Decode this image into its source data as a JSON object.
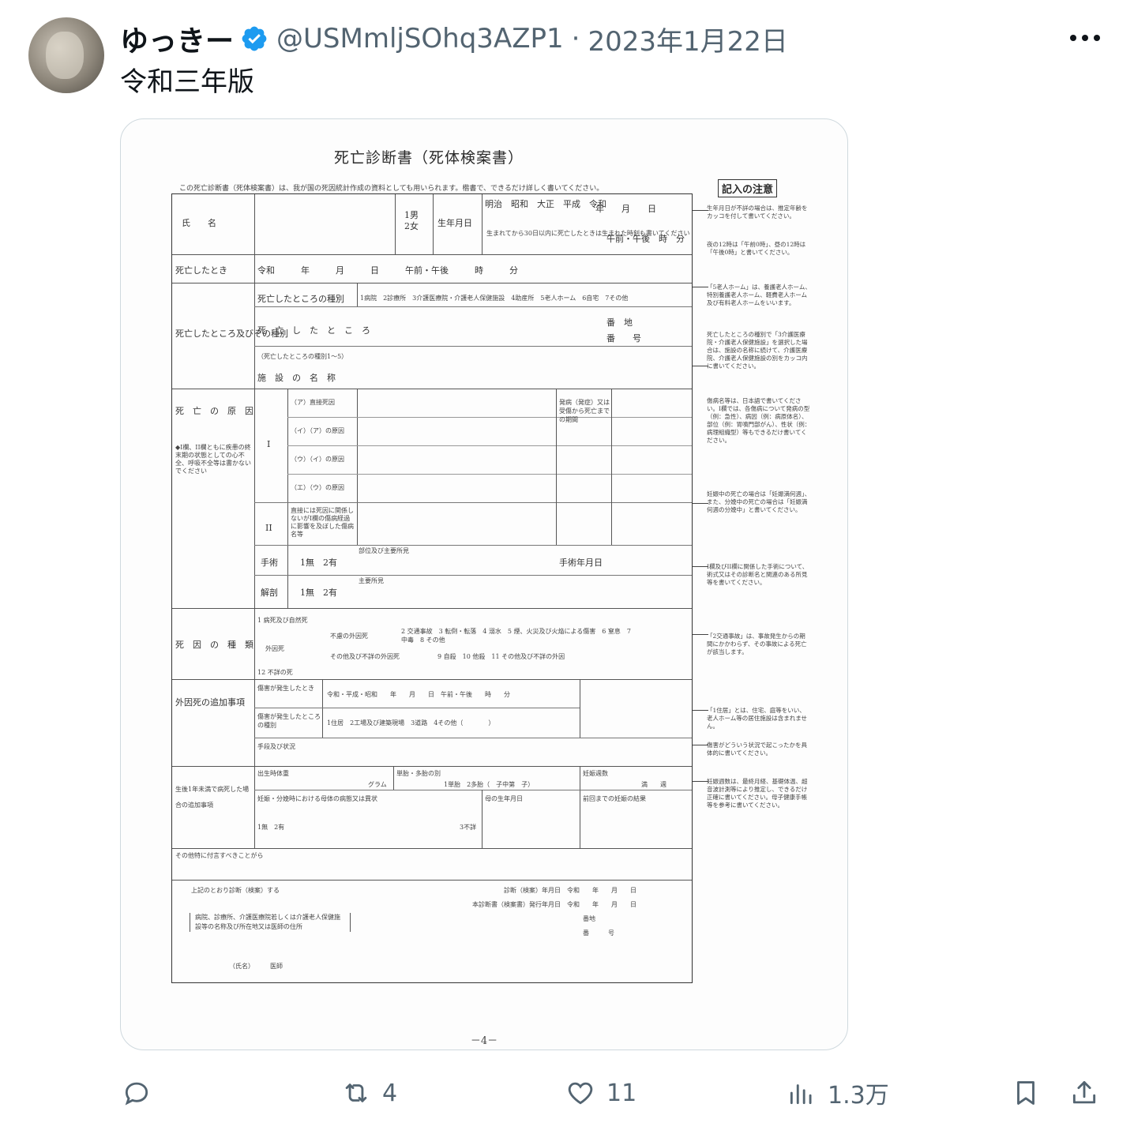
{
  "tweet": {
    "author_name": "ゆっきー",
    "handle": "@USMmljSOhq3AZP1",
    "separator": "·",
    "date": "2023年1月22日",
    "text": "令和三年版"
  },
  "document": {
    "title": "死亡診断書（死体検案書）",
    "intro": "この死亡診断書（死体検案書）は、我が国の死因統計作成の資料としても用いられます。楷書で、できるだけ詳しく書いてください。",
    "notes_header": "記入の注意",
    "page_number": "－4－",
    "rows": {
      "name": "氏　　名",
      "sex": "1男\n2女",
      "birth_label": "生年月日",
      "birth_eras": "明治　昭和　大正　平成　令和",
      "birth_ymd": "年　　月　　日",
      "birth_time": "午前・午後　時　分",
      "birth_note": "生まれてから30日以内に死亡したときは生まれた時刻も書いてください",
      "death_time_label": "死亡したとき",
      "death_time_value": "令和　　　年　　　月　　　日　　　午前・午後　　　時　　　分",
      "place_label": "死亡したところ及びその種別",
      "place_kind_label": "死亡したところの種別",
      "place_kind_value": "1病院　2診療所　3介護医療院・介護老人保健施設　4助産所　5老人ホーム　6自宅　7その他",
      "place_label2": "死　亡　し　た　と　こ　ろ",
      "place_addr": "番　地",
      "place_num": "番　　号",
      "facility_note": "（死亡したところの種別1～5）",
      "facility_label": "施　設　の　名　称",
      "cause_label": "死　亡　の　原　因",
      "cause_I": "I",
      "cause_II": "II",
      "cause_a": "（ア）直接死因",
      "cause_b": "（イ）（ア）の原因",
      "cause_c": "（ウ）（イ）の原因",
      "cause_d": "（エ）（ウ）の原因",
      "cause_II_note": "直接には死因に関係しないがI欄の傷病経過に影響を及ぼした傷病名等",
      "onset_note": "発病（発症）又は受傷から死亡までの期間",
      "cause_side_note": "◆I欄、II欄ともに疾患の終末期の状態としての心不全、呼吸不全等は書かないでください",
      "surgery_label": "手術",
      "surgery_value": "1無　2有",
      "surgery_detail": "部位及び主要所見",
      "surgery_date": "手術年月日",
      "autopsy_label": "解剖",
      "autopsy_value": "1無　2有",
      "autopsy_detail": "主要所見",
      "kind_label": "死　因　の　種　類",
      "kind_1": "1 病死及び自然死",
      "kind_ext": "外因死",
      "kind_unexpected": "不慮の外因死",
      "kind_unexpected_items": "2 交通事故　3 転倒・転落　4 溺水　5 煙、火災及び火焔による傷害　6 窒息　7 中毒　8 その他",
      "kind_other": "その他及び不詳の外因死",
      "kind_other_items": "9 自殺　10 他殺　11 その他及び不詳の外因",
      "kind_12": "12 不詳の死",
      "ext_label": "外因死の追加事項",
      "ext_when": "傷害が発生したとき",
      "ext_when_value": "令和・平成・昭和　　年　　月　　日　午前・午後　　時　　分",
      "ext_where": "傷害が発生したところの種別",
      "ext_where_value": "1住居　2工場及び建築現場　3道路　4その他（　　　　）",
      "ext_how": "手段及び状況",
      "infant_label": "生後1年未満で病死した場合の追加事項",
      "infant_weight": "出生時体重",
      "infant_gram": "グラム",
      "infant_multi": "単胎・多胎の別",
      "infant_multi_value": "1単胎　2多胎（　子中第　子）",
      "infant_weeks": "妊娠週数",
      "infant_weeks_value": "満　　週",
      "infant_mother": "妊娠・分娩時における母体の病態又は異状",
      "infant_mother_value": "1無　2有",
      "infant_unknown": "3不詳",
      "infant_mother_birth": "母の生年月日",
      "infant_prev": "前回までの妊娠の結果",
      "other_label": "その他特に付言すべきことがら",
      "cert_line": "上記のとおり診断（検案）する",
      "cert_date1": "診断（検案）年月日　令和　　年　　月　　日",
      "cert_date2": "本診断書（検案書）発行年月日　令和　　年　　月　　日",
      "cert_place": "病院、診療所、介護医療院若しくは介護老人保健施設等の名称及び所在地又は医師の住所",
      "cert_addr": "番地",
      "cert_num": "番　　　号",
      "cert_name": "（氏名）　　　医師"
    },
    "notes": [
      "生年月日が不詳の場合は、推定年齢をカッコを付して書いてください。",
      "夜の12時は「午前0時」、昼の12時は「午後0時」と書いてください。",
      "「5老人ホーム」は、養護老人ホーム、特別養護老人ホーム、軽費老人ホーム及び有料老人ホームをいいます。",
      "死亡したところの種別で「3介護医療院・介護老人保健施設」を選択した場合は、施設の名称に続けて、介護医療院、介護老人保健施設の別をカッコ内に書いてください。",
      "傷病名等は、日本語で書いてください。I欄では、各傷病について発病の型（例：急性）、病因（例：病原体名）、部位（例：胃噴門部がん）、性状（例：病理組織型）等もできるだけ書いてください。",
      "妊娠中の死亡の場合は「妊娠満何週」、また、分娩中の死亡の場合は「妊娠満何週の分娩中」と書いてください。",
      "I欄及びII欄に関係した手術について、術式又はその診断名と関連のある所見等を書いてください。",
      "「2交通事故」は、事故発生からの期間にかかわらず、その事故による死亡が該当します。",
      "「1住居」とは、住宅、庭等をいい、老人ホーム等の居住施設は含まれません。",
      "傷害がどういう状況で起こったかを具体的に書いてください。",
      "妊娠週数は、最終月経、基礎体温、超音波計測等により推定し、できるだけ正確に書いてください。母子健康手帳等を参考に書いてください。"
    ]
  },
  "actions": {
    "reply_count": "",
    "retweet_count": "4",
    "like_count": "11",
    "views_count": "1.3万"
  },
  "colors": {
    "text": "#0f1419",
    "secondary": "#536471",
    "verified": "#1d9bf0",
    "border": "#cfd9de"
  },
  "icons": [
    "more-icon",
    "verified-badge-icon",
    "reply-icon",
    "retweet-icon",
    "like-icon",
    "views-icon",
    "bookmark-icon",
    "share-icon"
  ]
}
